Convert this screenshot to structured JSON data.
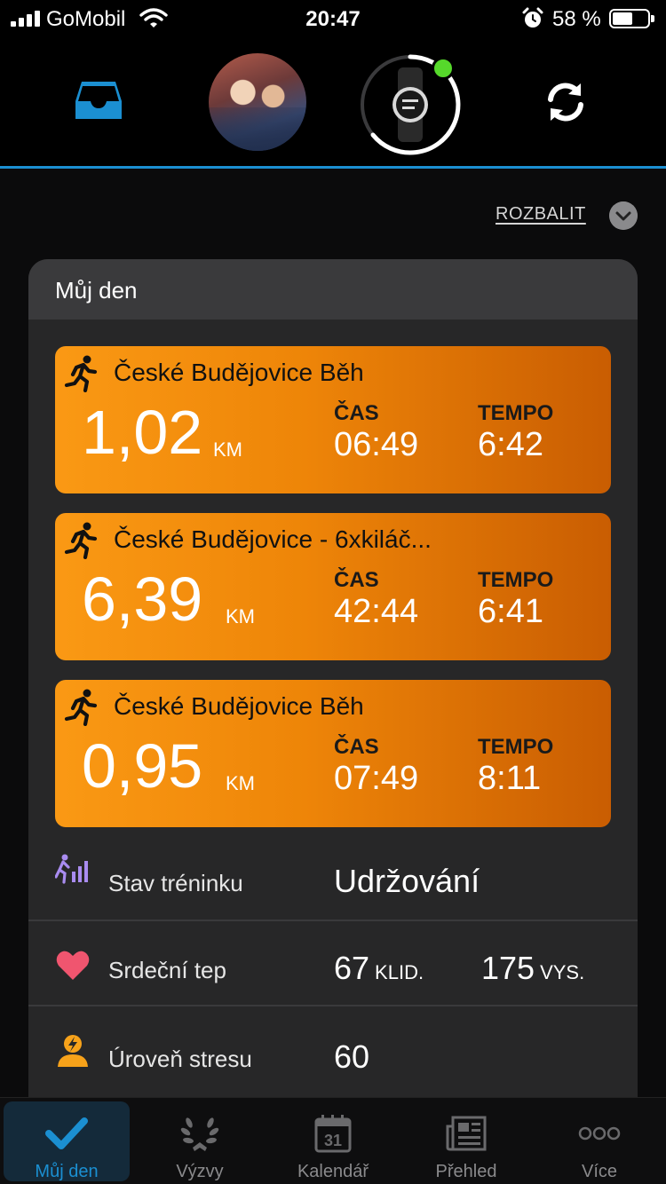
{
  "status_bar": {
    "carrier": "GoMobil",
    "time": "20:47",
    "battery_percent": "58 %",
    "battery_level": 0.58
  },
  "top_nav": {
    "accent_color": "#1b8fd1",
    "device_connected_color": "#56d92b"
  },
  "expand_label": "ROZBALIT",
  "my_day": {
    "title": "Můj den",
    "activities": [
      {
        "name": "České Budějovice Běh",
        "distance": "1,02",
        "unit": "KM",
        "time_label": "ČAS",
        "time": "06:49",
        "pace_label": "TEMPO",
        "pace": "6:42"
      },
      {
        "name": "České Budějovice - 6xkiláč...",
        "distance": "6,39",
        "unit": "KM",
        "time_label": "ČAS",
        "time": "42:44",
        "pace_label": "TEMPO",
        "pace": "6:41"
      },
      {
        "name": "České Budějovice Běh",
        "distance": "0,95",
        "unit": "KM",
        "time_label": "ČAS",
        "time": "07:49",
        "pace_label": "TEMPO",
        "pace": "8:11"
      }
    ],
    "training_status": {
      "label": "Stav tréninku",
      "value": "Udržování"
    },
    "heart_rate": {
      "label": "Srdeční tep",
      "resting": "67",
      "resting_label": "KLID.",
      "max": "175",
      "max_label": "VYS."
    },
    "stress": {
      "label": "Úroveň stresu",
      "value": "60"
    }
  },
  "tab_bar": {
    "tabs": [
      {
        "label": "Můj den",
        "icon": "checkmark-icon",
        "active": true
      },
      {
        "label": "Výzvy",
        "icon": "laurel-icon",
        "active": false
      },
      {
        "label": "Kalendář",
        "icon": "calendar-icon",
        "active": false,
        "calendar_day": "31"
      },
      {
        "label": "Přehled",
        "icon": "newspaper-icon",
        "active": false
      },
      {
        "label": "Více",
        "icon": "more-dots-icon",
        "active": false
      }
    ]
  }
}
